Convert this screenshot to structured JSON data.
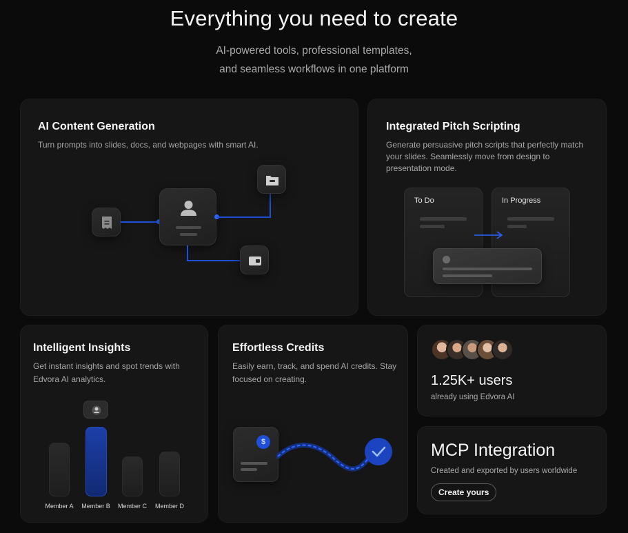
{
  "hero": {
    "title": "Everything you need to create",
    "subtitle_line1": "AI-powered tools, professional templates,",
    "subtitle_line2": "and seamless workflows in one platform"
  },
  "cards": {
    "ai_content": {
      "title": "AI Content Generation",
      "desc": "Turn prompts into slides, docs, and webpages with smart AI."
    },
    "pitch": {
      "title": "Integrated Pitch Scripting",
      "desc": "Generate persuasive pitch scripts that perfectly match your slides. Seamlessly move from design to presentation mode.",
      "col1": "To Do",
      "col2": "In Progress"
    },
    "insights": {
      "title": "Intelligent Insights",
      "desc": "Get instant insights and spot trends with Edvora AI analytics.",
      "members": [
        "Member A",
        "Member B",
        "Member C",
        "Member D"
      ],
      "highlighted": "Member B"
    },
    "credits": {
      "title": "Effortless Credits",
      "desc": "Easily earn, track, and spend AI credits. Stay focused on creating.",
      "currency_symbol": "$"
    },
    "users": {
      "count": "1.25K+ users",
      "caption": "already using Edvora AI"
    },
    "mcp": {
      "title": "MCP Integration",
      "caption": "Created and exported by users worldwide",
      "button": "Create yours"
    }
  },
  "colors": {
    "accent_blue": "#1f4fd8",
    "background": "#0b0b0b",
    "card": "#161616"
  },
  "icons": [
    "receipt-icon",
    "user-icon",
    "folder-icon",
    "wallet-icon",
    "arrow-right-icon",
    "checkmark-icon",
    "dollar-icon"
  ]
}
